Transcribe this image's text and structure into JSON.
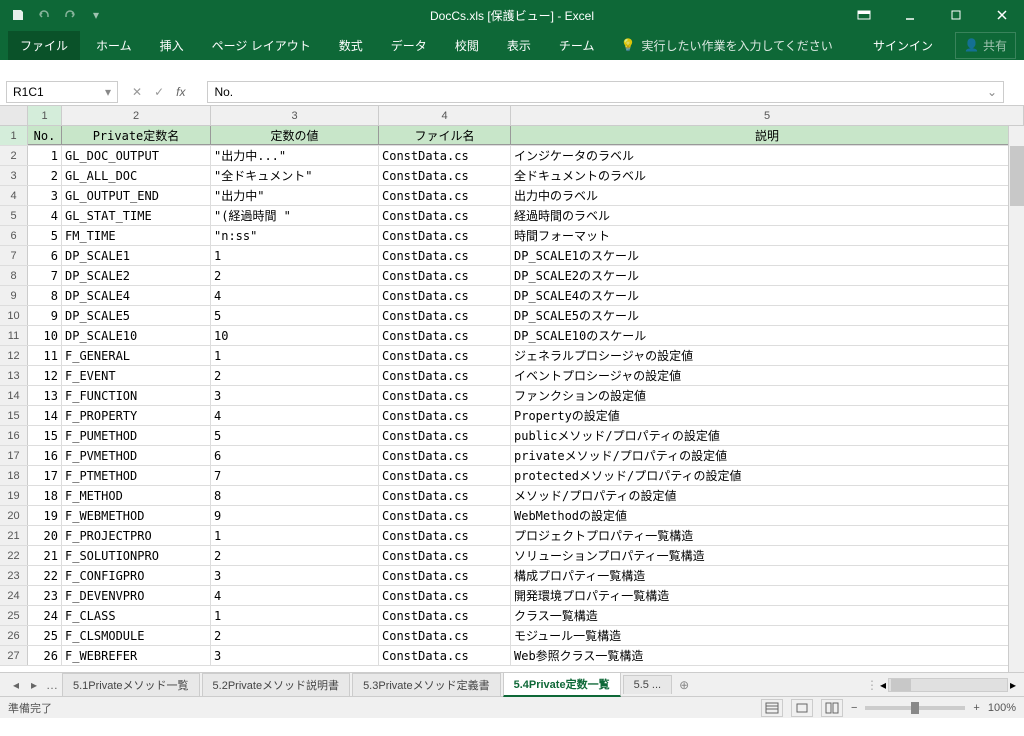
{
  "title": "DocCs.xls [保護ビュー] - Excel",
  "ribbon": {
    "file": "ファイル",
    "home": "ホーム",
    "insert": "挿入",
    "layout": "ページ レイアウト",
    "formula": "数式",
    "data": "データ",
    "review": "校閲",
    "view": "表示",
    "team": "チーム",
    "tellme": "実行したい作業を入力してください",
    "signin": "サインイン",
    "share": "共有"
  },
  "namebox": "R1C1",
  "formula": "No.",
  "cols": [
    "1",
    "2",
    "3",
    "4",
    "5"
  ],
  "headers": {
    "no": "No.",
    "name": "Private定数名",
    "value": "定数の値",
    "file": "ファイル名",
    "desc": "説明"
  },
  "rows": [
    {
      "r": "1",
      "no": ""
    },
    {
      "r": "2",
      "no": "1",
      "name": "GL_DOC_OUTPUT",
      "val": "\"出力中...\"",
      "file": "ConstData.cs",
      "desc": "インジケータのラベル"
    },
    {
      "r": "3",
      "no": "2",
      "name": "GL_ALL_DOC",
      "val": "\"全ドキュメント\"",
      "file": "ConstData.cs",
      "desc": "全ドキュメントのラベル"
    },
    {
      "r": "4",
      "no": "3",
      "name": "GL_OUTPUT_END",
      "val": "\"出力中\"",
      "file": "ConstData.cs",
      "desc": "出力中のラベル"
    },
    {
      "r": "5",
      "no": "4",
      "name": "GL_STAT_TIME",
      "val": "\"(経過時間 \"",
      "file": "ConstData.cs",
      "desc": "経過時間のラベル"
    },
    {
      "r": "6",
      "no": "5",
      "name": "FM_TIME",
      "val": "\"n:ss\"",
      "file": "ConstData.cs",
      "desc": "時間フォーマット"
    },
    {
      "r": "7",
      "no": "6",
      "name": "DP_SCALE1",
      "val": "1",
      "file": "ConstData.cs",
      "desc": "DP_SCALE1のスケール"
    },
    {
      "r": "8",
      "no": "7",
      "name": "DP_SCALE2",
      "val": "2",
      "file": "ConstData.cs",
      "desc": "DP_SCALE2のスケール"
    },
    {
      "r": "9",
      "no": "8",
      "name": "DP_SCALE4",
      "val": "4",
      "file": "ConstData.cs",
      "desc": "DP_SCALE4のスケール"
    },
    {
      "r": "10",
      "no": "9",
      "name": "DP_SCALE5",
      "val": "5",
      "file": "ConstData.cs",
      "desc": "DP_SCALE5のスケール"
    },
    {
      "r": "11",
      "no": "10",
      "name": "DP_SCALE10",
      "val": "10",
      "file": "ConstData.cs",
      "desc": "DP_SCALE10のスケール"
    },
    {
      "r": "12",
      "no": "11",
      "name": "F_GENERAL",
      "val": "1",
      "file": "ConstData.cs",
      "desc": "ジェネラルプロシージャの設定値"
    },
    {
      "r": "13",
      "no": "12",
      "name": "F_EVENT",
      "val": "2",
      "file": "ConstData.cs",
      "desc": "イベントプロシージャの設定値"
    },
    {
      "r": "14",
      "no": "13",
      "name": "F_FUNCTION",
      "val": "3",
      "file": "ConstData.cs",
      "desc": "ファンクションの設定値"
    },
    {
      "r": "15",
      "no": "14",
      "name": "F_PROPERTY",
      "val": "4",
      "file": "ConstData.cs",
      "desc": "Propertyの設定値"
    },
    {
      "r": "16",
      "no": "15",
      "name": "F_PUMETHOD",
      "val": "5",
      "file": "ConstData.cs",
      "desc": "publicメソッド/プロパティの設定値"
    },
    {
      "r": "17",
      "no": "16",
      "name": "F_PVMETHOD",
      "val": "6",
      "file": "ConstData.cs",
      "desc": "privateメソッド/プロパティの設定値"
    },
    {
      "r": "18",
      "no": "17",
      "name": "F_PTMETHOD",
      "val": "7",
      "file": "ConstData.cs",
      "desc": "protectedメソッド/プロパティの設定値"
    },
    {
      "r": "19",
      "no": "18",
      "name": "F_METHOD",
      "val": "8",
      "file": "ConstData.cs",
      "desc": "メソッド/プロパティの設定値"
    },
    {
      "r": "20",
      "no": "19",
      "name": "F_WEBMETHOD",
      "val": "9",
      "file": "ConstData.cs",
      "desc": "WebMethodの設定値"
    },
    {
      "r": "21",
      "no": "20",
      "name": "F_PROJECTPRO",
      "val": "1",
      "file": "ConstData.cs",
      "desc": "プロジェクトプロパティ一覧構造"
    },
    {
      "r": "22",
      "no": "21",
      "name": "F_SOLUTIONPRO",
      "val": "2",
      "file": "ConstData.cs",
      "desc": "ソリューションプロパティ一覧構造"
    },
    {
      "r": "23",
      "no": "22",
      "name": "F_CONFIGPRO",
      "val": "3",
      "file": "ConstData.cs",
      "desc": "構成プロパティ一覧構造"
    },
    {
      "r": "24",
      "no": "23",
      "name": "F_DEVENVPRO",
      "val": "4",
      "file": "ConstData.cs",
      "desc": "開発環境プロパティ一覧構造"
    },
    {
      "r": "25",
      "no": "24",
      "name": "F_CLASS",
      "val": "1",
      "file": "ConstData.cs",
      "desc": "クラス一覧構造"
    },
    {
      "r": "26",
      "no": "25",
      "name": "F_CLSMODULE",
      "val": "2",
      "file": "ConstData.cs",
      "desc": "モジュール一覧構造"
    },
    {
      "r": "27",
      "no": "26",
      "name": "F_WEBREFER",
      "val": "3",
      "file": "ConstData.cs",
      "desc": "Web参照クラス一覧構造"
    }
  ],
  "tabs": {
    "t1": "5.1Privateメソッド一覧",
    "t2": "5.2Privateメソッド説明書",
    "t3": "5.3Privateメソッド定義書",
    "t4": "5.4Private定数一覧",
    "t5": "5.5 ..."
  },
  "status": {
    "ready": "準備完了",
    "zoom": "100%"
  }
}
